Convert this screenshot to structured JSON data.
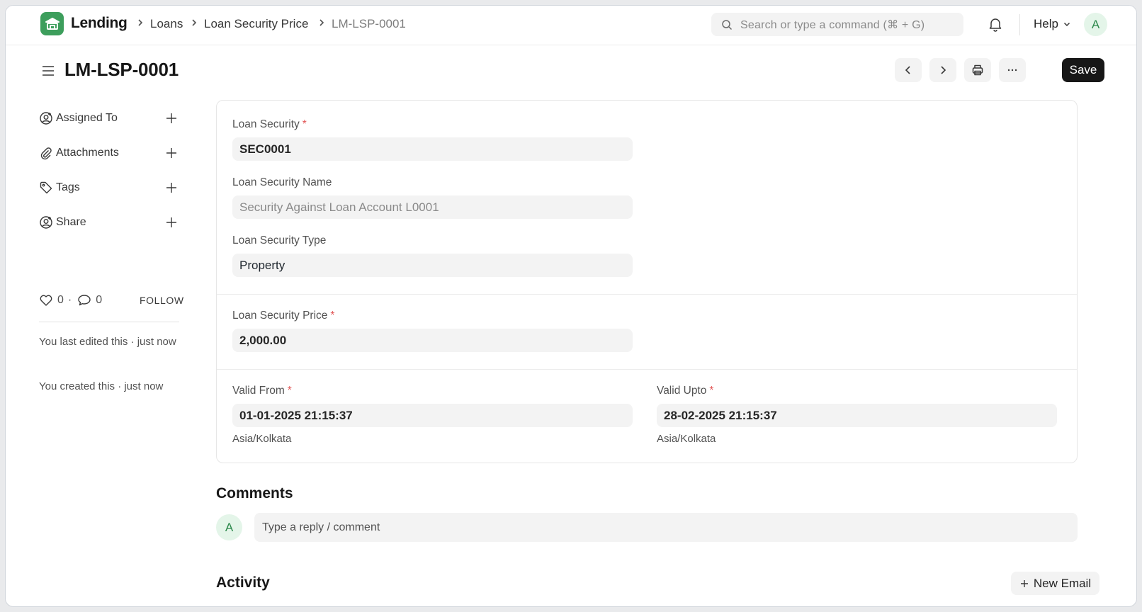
{
  "navbar": {
    "app_title": "Lending",
    "breadcrumbs": [
      "Loans",
      "Loan Security Price",
      "LM-LSP-0001"
    ],
    "search_placeholder": "Search or type a command (⌘ + G)",
    "help_label": "Help",
    "user_initial": "A"
  },
  "page": {
    "title": "LM-LSP-0001",
    "save_label": "Save"
  },
  "sidebar": {
    "items": [
      {
        "label": "Assigned To",
        "icon": "user-add-icon"
      },
      {
        "label": "Attachments",
        "icon": "paperclip-icon"
      },
      {
        "label": "Tags",
        "icon": "tag-icon"
      },
      {
        "label": "Share",
        "icon": "share-user-icon"
      }
    ],
    "likes_count": "0",
    "comments_count": "0",
    "follow_label": "FOLLOW",
    "last_edited": "You last edited this · just now",
    "created": "You created this · just now"
  },
  "form": {
    "loan_security": {
      "label": "Loan Security",
      "value": "SEC0001",
      "required": true
    },
    "loan_security_name": {
      "label": "Loan Security Name",
      "value": "Security Against Loan Account L0001"
    },
    "loan_security_type": {
      "label": "Loan Security Type",
      "value": "Property"
    },
    "loan_security_price": {
      "label": "Loan Security Price",
      "value": "2,000.00",
      "required": true
    },
    "valid_from": {
      "label": "Valid From",
      "value": "01-01-2025 21:15:37",
      "timezone": "Asia/Kolkata",
      "required": true
    },
    "valid_upto": {
      "label": "Valid Upto",
      "value": "28-02-2025 21:15:37",
      "timezone": "Asia/Kolkata",
      "required": true
    }
  },
  "comments": {
    "title": "Comments",
    "user_initial": "A",
    "placeholder": "Type a reply / comment"
  },
  "activity": {
    "title": "Activity",
    "new_email_label": "New Email"
  },
  "colors": {
    "brand": "#3d9e5c",
    "primary_button": "#171717",
    "required": "#e25555"
  }
}
